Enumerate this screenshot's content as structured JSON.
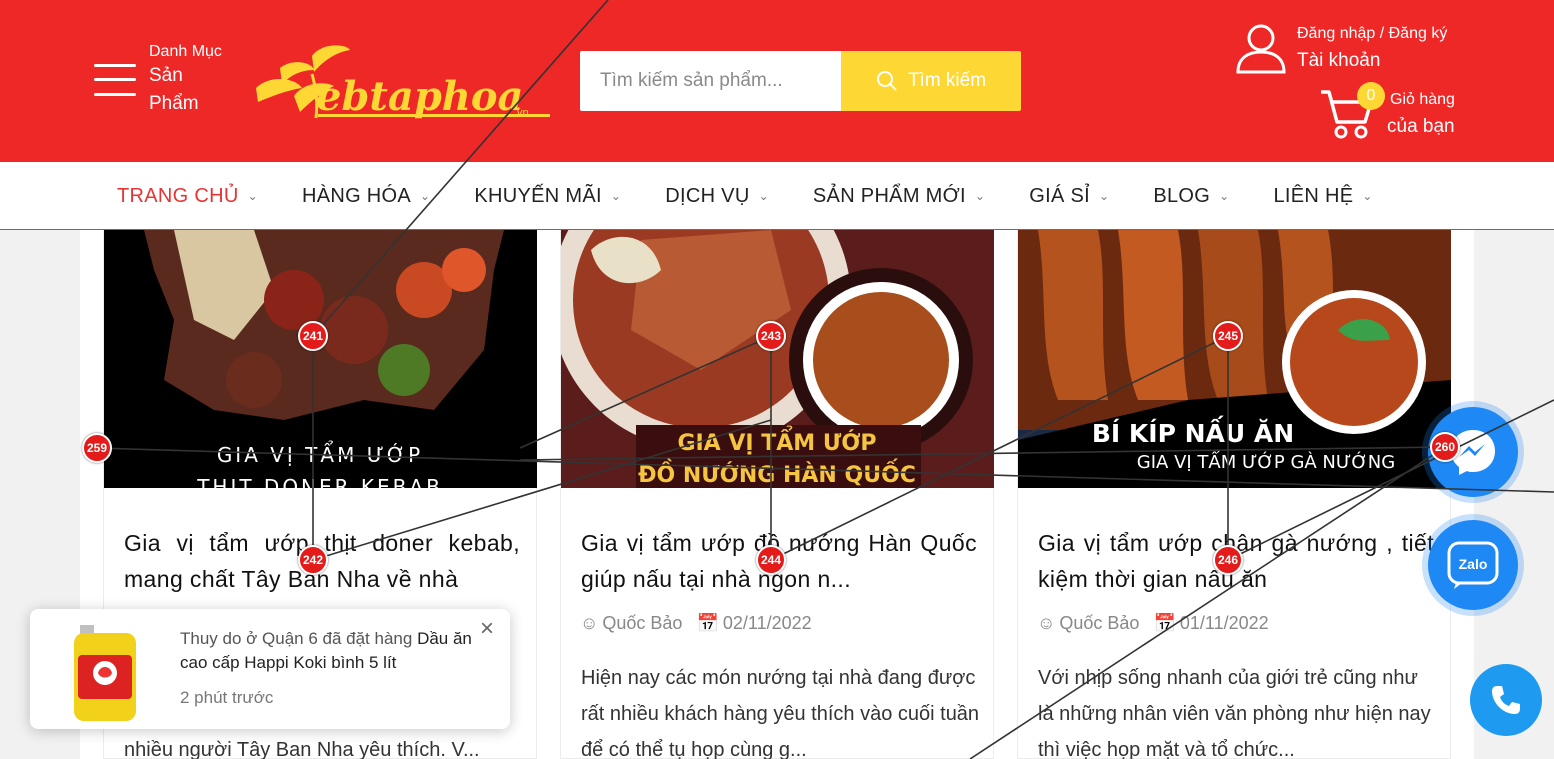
{
  "header": {
    "menu_line1": "Danh Mục",
    "menu_line2": "Sản",
    "menu_line3": "Phẩm",
    "logo_text": "ebtaphoa",
    "logo_sub": ".vn",
    "search_placeholder": "Tìm kiếm sản phẩm...",
    "search_button": "Tìm kiếm",
    "login_link": "Đăng nhập / Đăng ký",
    "account_label": "Tài khoản",
    "cart_count": "0",
    "cart_line1": "Giỏ hàng",
    "cart_line2": "của bạn"
  },
  "nav": {
    "items": [
      {
        "label": "TRANG CHỦ"
      },
      {
        "label": "HÀNG HÓA"
      },
      {
        "label": "KHUYẾN MÃI"
      },
      {
        "label": "DỊCH VỤ"
      },
      {
        "label": "SẢN PHẨM MỚI"
      },
      {
        "label": "GIÁ SỈ"
      },
      {
        "label": "BLOG"
      },
      {
        "label": "LIÊN HỆ"
      }
    ]
  },
  "posts": [
    {
      "image_caption_1": "GIA VỊ TẨM ƯỚP",
      "image_caption_2": "THỊT DONER KEBAB",
      "title": "Gia vị tẩm ướp thịt doner kebab, mang chất Tây Ban Nha về nhà",
      "author": "",
      "date": "",
      "excerpt": "nhiều người Tây Ban Nha yêu thích. V..."
    },
    {
      "image_caption_1": "GIA VỊ TẨM ƯỚP",
      "image_caption_2": "ĐỒ NƯỚNG HÀN QUỐC",
      "title": "Gia vị tẩm ướp đồ nướng Hàn Quốc giúp nấu tại nhà ngon n...",
      "author": "Quốc Bảo",
      "date": "02/11/2022",
      "excerpt": "Hiện nay các món nướng tại nhà đang được rất nhiều khách hàng yêu thích vào cuối tuần để có thể tụ họp cùng g..."
    },
    {
      "image_caption_1": "BÍ KÍP NẤU ĂN",
      "image_caption_2": "GIA VỊ TẨM ƯỚP GÀ NƯỚNG",
      "title": "Gia vị tẩm ướp chân gà nướng , tiết kiệm thời gian nấu ăn",
      "author": "Quốc Bảo",
      "date": "01/11/2022",
      "excerpt": "Với nhịp sống nhanh của giới trẻ cũng như là những nhân viên văn phòng như hiện nay thì việc họp mặt và tổ chức..."
    }
  ],
  "popup": {
    "message": "Thuy do ở Quận 6 đã đặt hàng",
    "product": "Dầu ăn cao cấp Happi Koki bình 5 lít",
    "time": "2 phút trước",
    "close": "×"
  },
  "markers": [
    "241",
    "242",
    "243",
    "244",
    "245",
    "246",
    "259",
    "260"
  ],
  "colors": {
    "brand_red": "#ee2727",
    "accent_yellow": "#fdd835",
    "nav_active": "#e73434",
    "fab_blue": "#1e88f5"
  }
}
